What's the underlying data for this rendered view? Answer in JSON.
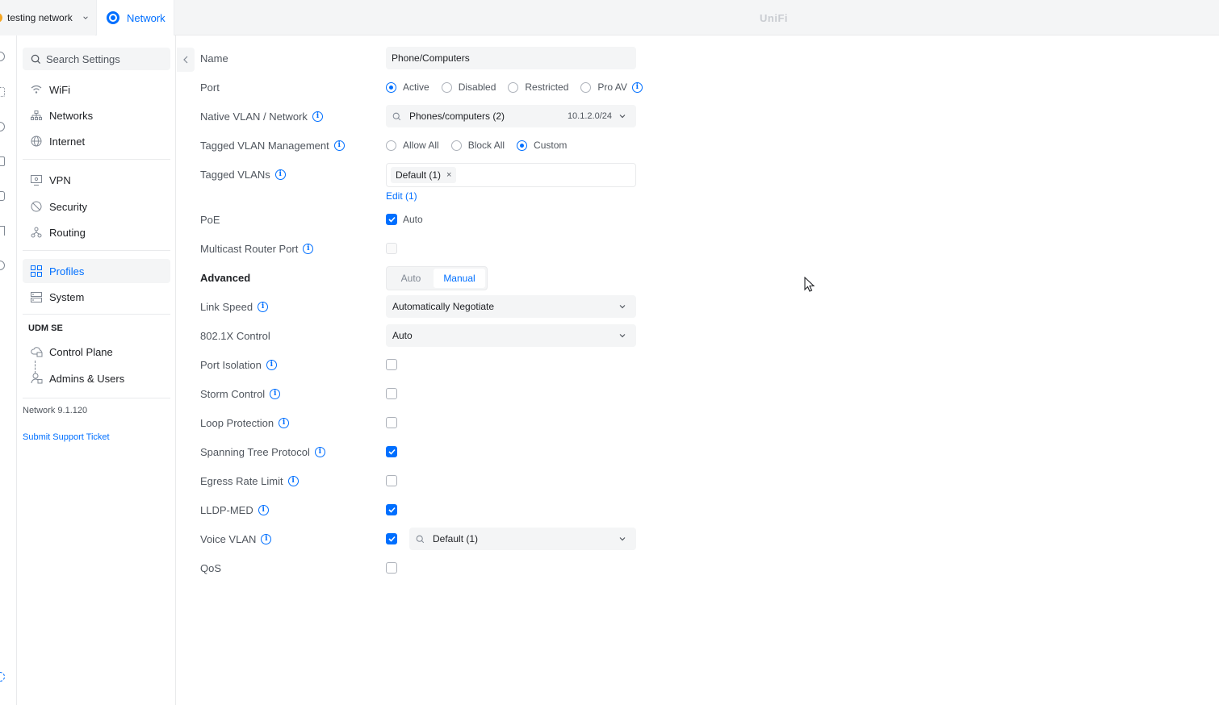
{
  "topbar": {
    "site_name": "testing network",
    "app_tab_label": "Network",
    "brand": "UniFi"
  },
  "sidebar": {
    "search_placeholder": "Search Settings",
    "items": [
      {
        "label": "WiFi",
        "icon": "wifi-icon"
      },
      {
        "label": "Networks",
        "icon": "networks-icon"
      },
      {
        "label": "Internet",
        "icon": "globe-icon"
      },
      {
        "label": "VPN",
        "icon": "vpn-icon"
      },
      {
        "label": "Security",
        "icon": "shield-icon"
      },
      {
        "label": "Routing",
        "icon": "routing-icon"
      },
      {
        "label": "Profiles",
        "icon": "profiles-icon",
        "active": true
      },
      {
        "label": "System",
        "icon": "system-icon"
      }
    ],
    "section_title": "UDM SE",
    "device_items": [
      {
        "label": "Control Plane",
        "icon": "cloud-icon"
      },
      {
        "label": "Admins & Users",
        "icon": "users-icon"
      }
    ],
    "version": "Network 9.1.120",
    "support_link": "Submit Support Ticket"
  },
  "form": {
    "name": {
      "label": "Name",
      "value": "Phone/Computers"
    },
    "port": {
      "label": "Port",
      "options": [
        "Active",
        "Disabled",
        "Restricted",
        "Pro AV"
      ],
      "selected": "Active"
    },
    "native_vlan": {
      "label": "Native VLAN / Network",
      "value": "Phones/computers (2)",
      "subnet": "10.1.2.0/24"
    },
    "tagged_vlan_mgmt": {
      "label": "Tagged VLAN Management",
      "options": [
        "Allow All",
        "Block All",
        "Custom"
      ],
      "selected": "Custom"
    },
    "tagged_vlans": {
      "label": "Tagged VLANs",
      "tag": "Default (1)",
      "tag_remove": "×",
      "edit_link": "Edit (1)"
    },
    "poe": {
      "label": "PoE",
      "checkbox_label": "Auto",
      "checked": true
    },
    "multicast_router_port": {
      "label": "Multicast Router Port",
      "checked": false
    },
    "advanced": {
      "label": "Advanced",
      "options": [
        "Auto",
        "Manual"
      ],
      "selected": "Manual"
    },
    "link_speed": {
      "label": "Link Speed",
      "value": "Automatically Negotiate"
    },
    "dot1x": {
      "label": "802.1X Control",
      "value": "Auto"
    },
    "port_isolation": {
      "label": "Port Isolation",
      "checked": false
    },
    "storm_control": {
      "label": "Storm Control",
      "checked": false
    },
    "loop_protection": {
      "label": "Loop Protection",
      "checked": false
    },
    "stp": {
      "label": "Spanning Tree Protocol",
      "checked": true
    },
    "egress_rate_limit": {
      "label": "Egress Rate Limit",
      "checked": false
    },
    "lldp_med": {
      "label": "LLDP-MED",
      "checked": true
    },
    "voice_vlan": {
      "label": "Voice VLAN",
      "checked": true,
      "value": "Default (1)"
    },
    "qos": {
      "label": "QoS",
      "checked": false
    }
  },
  "colors": {
    "accent": "#006fff",
    "muted": "#50565e",
    "panel": "#f4f5f6"
  }
}
